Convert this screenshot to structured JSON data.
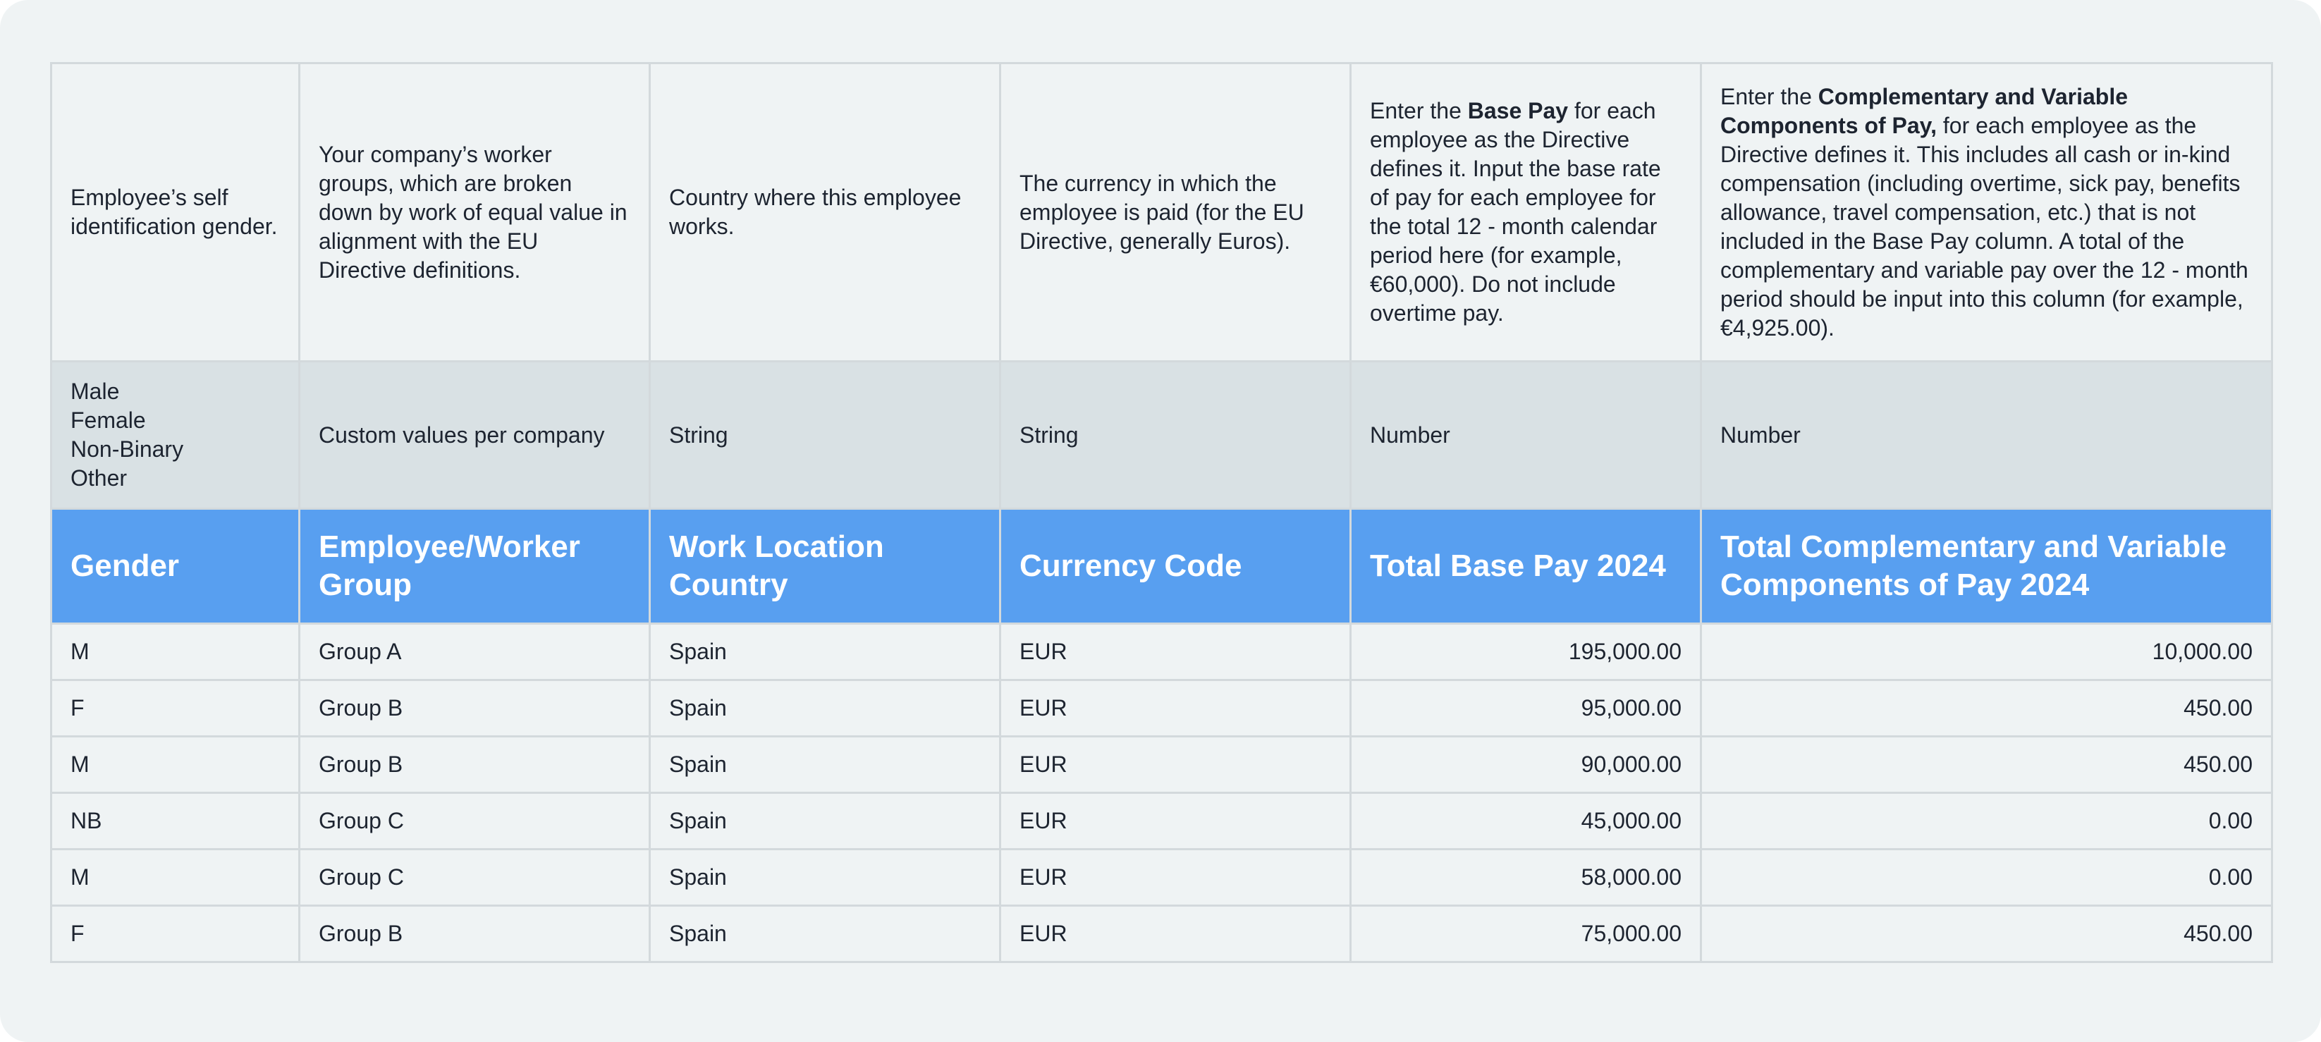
{
  "descriptions": {
    "gender": "Employee’s self identification gender.",
    "group": "Your company’s worker groups, which are broken down by work of equal value in alignment with the EU Directive definitions.",
    "country": "Country where this employee works.",
    "currency": "The currency in which the employee is paid (for the EU Directive, generally Euros).",
    "base_pay_pre": "Enter the ",
    "base_pay_bold": "Base Pay",
    "base_pay_post": " for each employee as the Directive defines it. Input the base rate of pay for each employee for the total 12 - month calendar period here (for example, €60,000). Do not include overtime pay.",
    "variable_pre": "Enter the  ",
    "variable_bold": "Complementary and Variable Components of Pay,",
    "variable_post": " for each employee as the Directive defines it. This includes all cash or in-kind compensation (including overtime, sick pay, benefits allowance, travel compensation, etc.) that is not included in the Base Pay column. A total of the complementary and variable pay over the 12 - month period should be input into this column (for example, €4,925.00)."
  },
  "types": {
    "gender_options": [
      "Male",
      "Female",
      "Non-Binary",
      "Other"
    ],
    "group": "Custom values per company",
    "country": "String",
    "currency": "String",
    "base_pay": "Number",
    "variable": "Number"
  },
  "headers": {
    "gender": "Gender",
    "group": "Employee/Worker Group",
    "country": "Work Location Country",
    "currency": "Currency Code",
    "base_pay": "Total Base Pay 2024",
    "variable": "Total Complementary and Variable Components of Pay 2024"
  },
  "rows": [
    {
      "gender": "M",
      "group": "Group A",
      "country": "Spain",
      "currency": "EUR",
      "base_pay": "195,000.00",
      "variable": "10,000.00"
    },
    {
      "gender": "F",
      "group": "Group B",
      "country": "Spain",
      "currency": "EUR",
      "base_pay": "95,000.00",
      "variable": "450.00"
    },
    {
      "gender": "M",
      "group": "Group B",
      "country": "Spain",
      "currency": "EUR",
      "base_pay": "90,000.00",
      "variable": "450.00"
    },
    {
      "gender": "NB",
      "group": "Group C",
      "country": "Spain",
      "currency": "EUR",
      "base_pay": "45,000.00",
      "variable": "0.00"
    },
    {
      "gender": "M",
      "group": "Group C",
      "country": "Spain",
      "currency": "EUR",
      "base_pay": "58,000.00",
      "variable": "0.00"
    },
    {
      "gender": "F",
      "group": "Group B",
      "country": "Spain",
      "currency": "EUR",
      "base_pay": "75,000.00",
      "variable": "450.00"
    }
  ]
}
